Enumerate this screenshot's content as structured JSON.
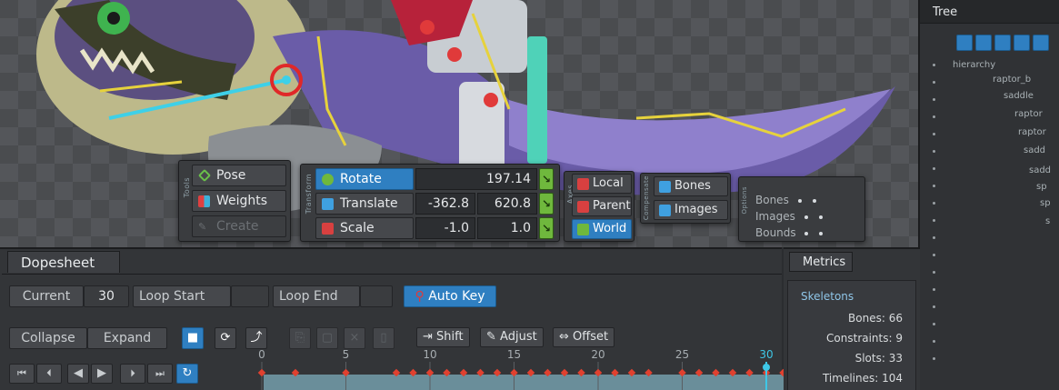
{
  "tools": {
    "section_label": "Tools",
    "pose": "Pose",
    "weights": "Weights",
    "create": "Create"
  },
  "transform": {
    "section_label": "Transform",
    "rotate": "Rotate",
    "translate": "Translate",
    "scale": "Scale",
    "rotate_value": "197.14",
    "translate_x": "-362.8",
    "translate_y": "620.8",
    "scale_x": "-1.0",
    "scale_y": "1.0",
    "key_glyph": "↘"
  },
  "axes": {
    "section_label": "Axes",
    "local": "Local",
    "parent": "Parent",
    "world": "World"
  },
  "compensate": {
    "section_label": "Compensate",
    "bones": "Bones",
    "images": "Images"
  },
  "options": {
    "section_label": "Options",
    "bones": "Bones",
    "images": "Images",
    "bounds": "Bounds"
  },
  "tree": {
    "title": "Tree",
    "rows": [
      "hierarchy",
      "raptor_b",
      "saddle",
      "raptor",
      "raptor",
      "sadd",
      "sadd",
      "sp",
      "sp",
      "s"
    ]
  },
  "dopesheet": {
    "title": "Dopesheet",
    "current_label": "Current",
    "current_value": "30",
    "loop_start": "Loop Start",
    "loop_end": "Loop End",
    "auto_key": "Auto Key",
    "collapse": "Collapse",
    "expand": "Expand",
    "shift": "Shift",
    "adjust": "Adjust",
    "offset": "Offset",
    "ticks": [
      "0",
      "5",
      "10",
      "15",
      "20",
      "25",
      "30"
    ]
  },
  "metrics": {
    "title": "Metrics",
    "skeletons": "Skeletons",
    "bones": "Bones: 66",
    "constraints": "Constraints: 9",
    "slots": "Slots: 33",
    "timelines": "Timelines: 104"
  },
  "colors": {
    "accent_blue": "#2f7fc1",
    "key_green": "#6fb83d",
    "keyframe_red": "#e0412f",
    "playhead_cyan": "#3ec7e6"
  }
}
